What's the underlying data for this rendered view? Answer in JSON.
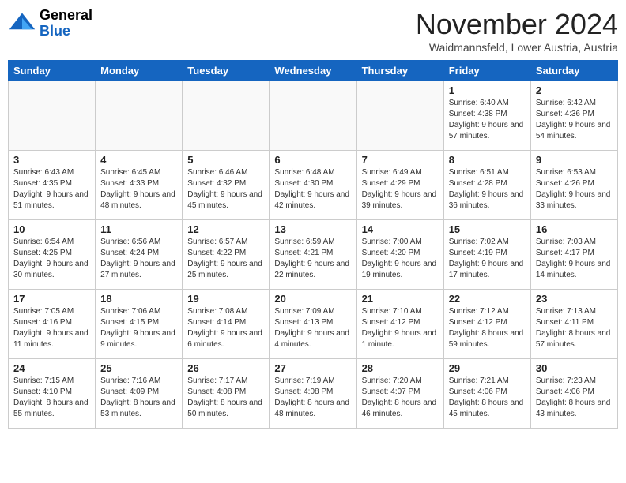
{
  "header": {
    "logo_line1": "General",
    "logo_line2": "Blue",
    "month_title": "November 2024",
    "location": "Waidmannsfeld, Lower Austria, Austria"
  },
  "days_of_week": [
    "Sunday",
    "Monday",
    "Tuesday",
    "Wednesday",
    "Thursday",
    "Friday",
    "Saturday"
  ],
  "weeks": [
    [
      {
        "day": "",
        "info": ""
      },
      {
        "day": "",
        "info": ""
      },
      {
        "day": "",
        "info": ""
      },
      {
        "day": "",
        "info": ""
      },
      {
        "day": "",
        "info": ""
      },
      {
        "day": "1",
        "info": "Sunrise: 6:40 AM\nSunset: 4:38 PM\nDaylight: 9 hours and 57 minutes."
      },
      {
        "day": "2",
        "info": "Sunrise: 6:42 AM\nSunset: 4:36 PM\nDaylight: 9 hours and 54 minutes."
      }
    ],
    [
      {
        "day": "3",
        "info": "Sunrise: 6:43 AM\nSunset: 4:35 PM\nDaylight: 9 hours and 51 minutes."
      },
      {
        "day": "4",
        "info": "Sunrise: 6:45 AM\nSunset: 4:33 PM\nDaylight: 9 hours and 48 minutes."
      },
      {
        "day": "5",
        "info": "Sunrise: 6:46 AM\nSunset: 4:32 PM\nDaylight: 9 hours and 45 minutes."
      },
      {
        "day": "6",
        "info": "Sunrise: 6:48 AM\nSunset: 4:30 PM\nDaylight: 9 hours and 42 minutes."
      },
      {
        "day": "7",
        "info": "Sunrise: 6:49 AM\nSunset: 4:29 PM\nDaylight: 9 hours and 39 minutes."
      },
      {
        "day": "8",
        "info": "Sunrise: 6:51 AM\nSunset: 4:28 PM\nDaylight: 9 hours and 36 minutes."
      },
      {
        "day": "9",
        "info": "Sunrise: 6:53 AM\nSunset: 4:26 PM\nDaylight: 9 hours and 33 minutes."
      }
    ],
    [
      {
        "day": "10",
        "info": "Sunrise: 6:54 AM\nSunset: 4:25 PM\nDaylight: 9 hours and 30 minutes."
      },
      {
        "day": "11",
        "info": "Sunrise: 6:56 AM\nSunset: 4:24 PM\nDaylight: 9 hours and 27 minutes."
      },
      {
        "day": "12",
        "info": "Sunrise: 6:57 AM\nSunset: 4:22 PM\nDaylight: 9 hours and 25 minutes."
      },
      {
        "day": "13",
        "info": "Sunrise: 6:59 AM\nSunset: 4:21 PM\nDaylight: 9 hours and 22 minutes."
      },
      {
        "day": "14",
        "info": "Sunrise: 7:00 AM\nSunset: 4:20 PM\nDaylight: 9 hours and 19 minutes."
      },
      {
        "day": "15",
        "info": "Sunrise: 7:02 AM\nSunset: 4:19 PM\nDaylight: 9 hours and 17 minutes."
      },
      {
        "day": "16",
        "info": "Sunrise: 7:03 AM\nSunset: 4:17 PM\nDaylight: 9 hours and 14 minutes."
      }
    ],
    [
      {
        "day": "17",
        "info": "Sunrise: 7:05 AM\nSunset: 4:16 PM\nDaylight: 9 hours and 11 minutes."
      },
      {
        "day": "18",
        "info": "Sunrise: 7:06 AM\nSunset: 4:15 PM\nDaylight: 9 hours and 9 minutes."
      },
      {
        "day": "19",
        "info": "Sunrise: 7:08 AM\nSunset: 4:14 PM\nDaylight: 9 hours and 6 minutes."
      },
      {
        "day": "20",
        "info": "Sunrise: 7:09 AM\nSunset: 4:13 PM\nDaylight: 9 hours and 4 minutes."
      },
      {
        "day": "21",
        "info": "Sunrise: 7:10 AM\nSunset: 4:12 PM\nDaylight: 9 hours and 1 minute."
      },
      {
        "day": "22",
        "info": "Sunrise: 7:12 AM\nSunset: 4:12 PM\nDaylight: 8 hours and 59 minutes."
      },
      {
        "day": "23",
        "info": "Sunrise: 7:13 AM\nSunset: 4:11 PM\nDaylight: 8 hours and 57 minutes."
      }
    ],
    [
      {
        "day": "24",
        "info": "Sunrise: 7:15 AM\nSunset: 4:10 PM\nDaylight: 8 hours and 55 minutes."
      },
      {
        "day": "25",
        "info": "Sunrise: 7:16 AM\nSunset: 4:09 PM\nDaylight: 8 hours and 53 minutes."
      },
      {
        "day": "26",
        "info": "Sunrise: 7:17 AM\nSunset: 4:08 PM\nDaylight: 8 hours and 50 minutes."
      },
      {
        "day": "27",
        "info": "Sunrise: 7:19 AM\nSunset: 4:08 PM\nDaylight: 8 hours and 48 minutes."
      },
      {
        "day": "28",
        "info": "Sunrise: 7:20 AM\nSunset: 4:07 PM\nDaylight: 8 hours and 46 minutes."
      },
      {
        "day": "29",
        "info": "Sunrise: 7:21 AM\nSunset: 4:06 PM\nDaylight: 8 hours and 45 minutes."
      },
      {
        "day": "30",
        "info": "Sunrise: 7:23 AM\nSunset: 4:06 PM\nDaylight: 8 hours and 43 minutes."
      }
    ]
  ]
}
